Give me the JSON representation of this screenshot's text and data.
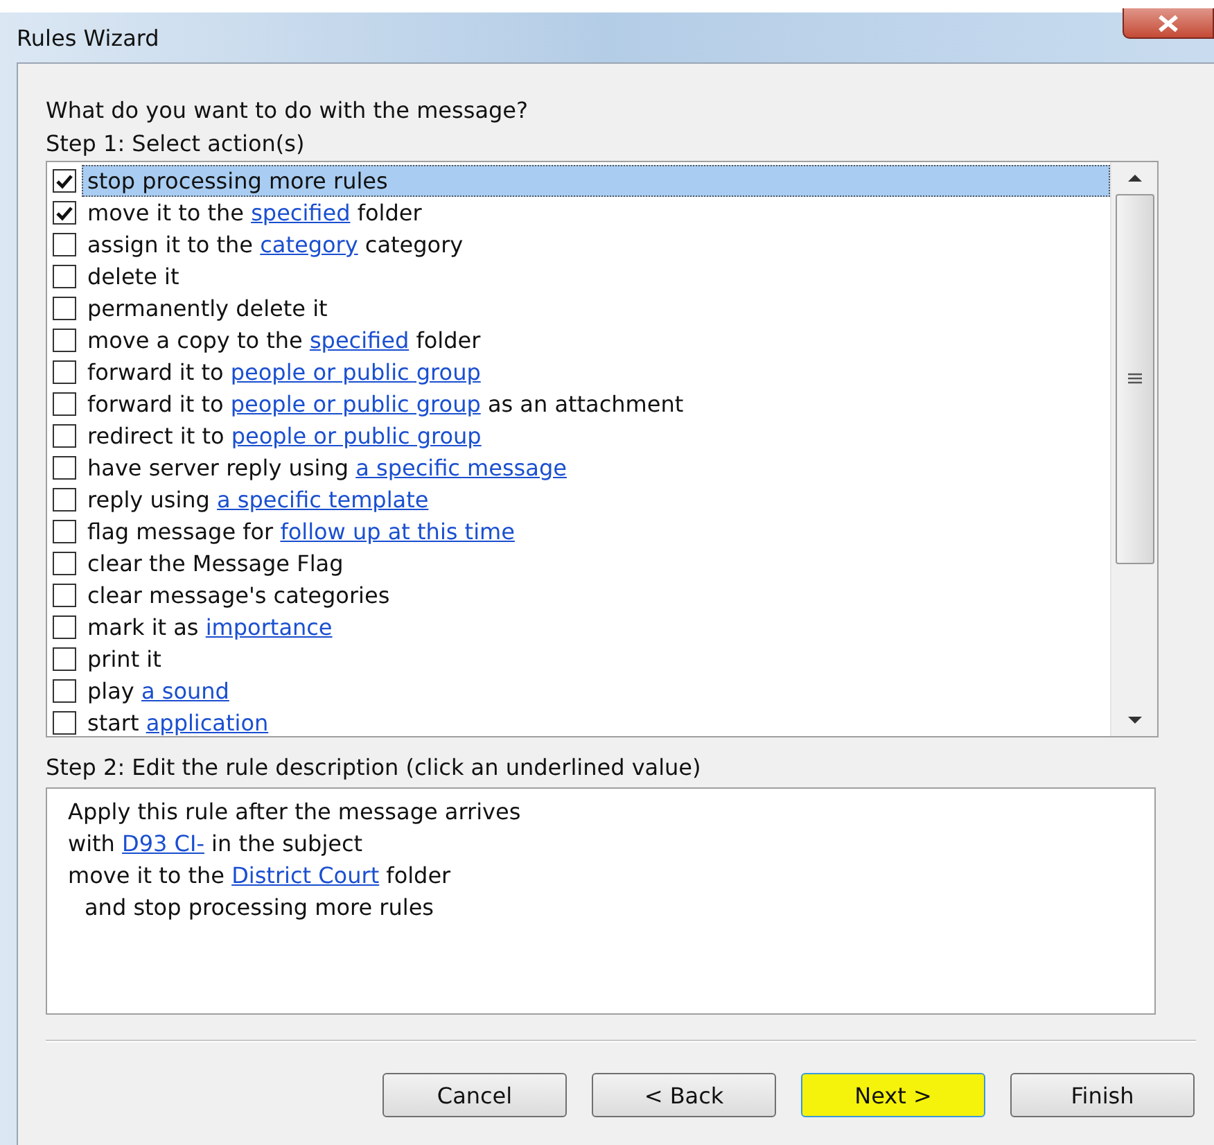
{
  "window": {
    "title": "Rules Wizard"
  },
  "prompt": "What do you want to do with the message?",
  "step1_label": "Step 1: Select action(s)",
  "actions": [
    {
      "checked": true,
      "selected": true,
      "parts": [
        {
          "kind": "text",
          "text": "stop processing more rules"
        }
      ]
    },
    {
      "checked": true,
      "selected": false,
      "parts": [
        {
          "kind": "text",
          "text": "move it to the "
        },
        {
          "kind": "link",
          "text": "specified"
        },
        {
          "kind": "text",
          "text": " folder"
        }
      ]
    },
    {
      "checked": false,
      "selected": false,
      "parts": [
        {
          "kind": "text",
          "text": "assign it to the "
        },
        {
          "kind": "link",
          "text": "category"
        },
        {
          "kind": "text",
          "text": " category"
        }
      ]
    },
    {
      "checked": false,
      "selected": false,
      "parts": [
        {
          "kind": "text",
          "text": "delete it"
        }
      ]
    },
    {
      "checked": false,
      "selected": false,
      "parts": [
        {
          "kind": "text",
          "text": "permanently delete it"
        }
      ]
    },
    {
      "checked": false,
      "selected": false,
      "parts": [
        {
          "kind": "text",
          "text": "move a copy to the "
        },
        {
          "kind": "link",
          "text": "specified"
        },
        {
          "kind": "text",
          "text": " folder"
        }
      ]
    },
    {
      "checked": false,
      "selected": false,
      "parts": [
        {
          "kind": "text",
          "text": "forward it to "
        },
        {
          "kind": "link",
          "text": "people or public group"
        }
      ]
    },
    {
      "checked": false,
      "selected": false,
      "parts": [
        {
          "kind": "text",
          "text": "forward it to "
        },
        {
          "kind": "link",
          "text": "people or public group"
        },
        {
          "kind": "text",
          "text": " as an attachment"
        }
      ]
    },
    {
      "checked": false,
      "selected": false,
      "parts": [
        {
          "kind": "text",
          "text": "redirect it to "
        },
        {
          "kind": "link",
          "text": "people or public group"
        }
      ]
    },
    {
      "checked": false,
      "selected": false,
      "parts": [
        {
          "kind": "text",
          "text": "have server reply using "
        },
        {
          "kind": "link",
          "text": "a specific message"
        }
      ]
    },
    {
      "checked": false,
      "selected": false,
      "parts": [
        {
          "kind": "text",
          "text": "reply using "
        },
        {
          "kind": "link",
          "text": "a specific template"
        }
      ]
    },
    {
      "checked": false,
      "selected": false,
      "parts": [
        {
          "kind": "text",
          "text": "flag message for "
        },
        {
          "kind": "link",
          "text": "follow up at this time"
        }
      ]
    },
    {
      "checked": false,
      "selected": false,
      "parts": [
        {
          "kind": "text",
          "text": "clear the Message Flag"
        }
      ]
    },
    {
      "checked": false,
      "selected": false,
      "parts": [
        {
          "kind": "text",
          "text": "clear message's categories"
        }
      ]
    },
    {
      "checked": false,
      "selected": false,
      "parts": [
        {
          "kind": "text",
          "text": "mark it as "
        },
        {
          "kind": "link",
          "text": "importance"
        }
      ]
    },
    {
      "checked": false,
      "selected": false,
      "parts": [
        {
          "kind": "text",
          "text": "print it"
        }
      ]
    },
    {
      "checked": false,
      "selected": false,
      "parts": [
        {
          "kind": "text",
          "text": "play "
        },
        {
          "kind": "link",
          "text": "a sound"
        }
      ]
    },
    {
      "checked": false,
      "selected": false,
      "parts": [
        {
          "kind": "text",
          "text": "start "
        },
        {
          "kind": "link",
          "text": "application"
        }
      ]
    }
  ],
  "step2_label": "Step 2: Edit the rule description (click an underlined value)",
  "description": [
    {
      "indent": false,
      "parts": [
        {
          "kind": "text",
          "text": "Apply this rule after the message arrives"
        }
      ]
    },
    {
      "indent": false,
      "parts": [
        {
          "kind": "text",
          "text": "with "
        },
        {
          "kind": "link",
          "text": "D93 CI-"
        },
        {
          "kind": "text",
          "text": " in the subject"
        }
      ]
    },
    {
      "indent": false,
      "parts": [
        {
          "kind": "text",
          "text": "move it to the "
        },
        {
          "kind": "link",
          "text": "District Court"
        },
        {
          "kind": "text",
          "text": " folder"
        }
      ]
    },
    {
      "indent": true,
      "parts": [
        {
          "kind": "text",
          "text": "and stop processing more rules"
        }
      ]
    }
  ],
  "buttons": [
    {
      "label": "Cancel",
      "highlighted": false
    },
    {
      "label": "< Back",
      "highlighted": false
    },
    {
      "label": "Next >",
      "highlighted": true
    },
    {
      "label": "Finish",
      "highlighted": false
    }
  ]
}
